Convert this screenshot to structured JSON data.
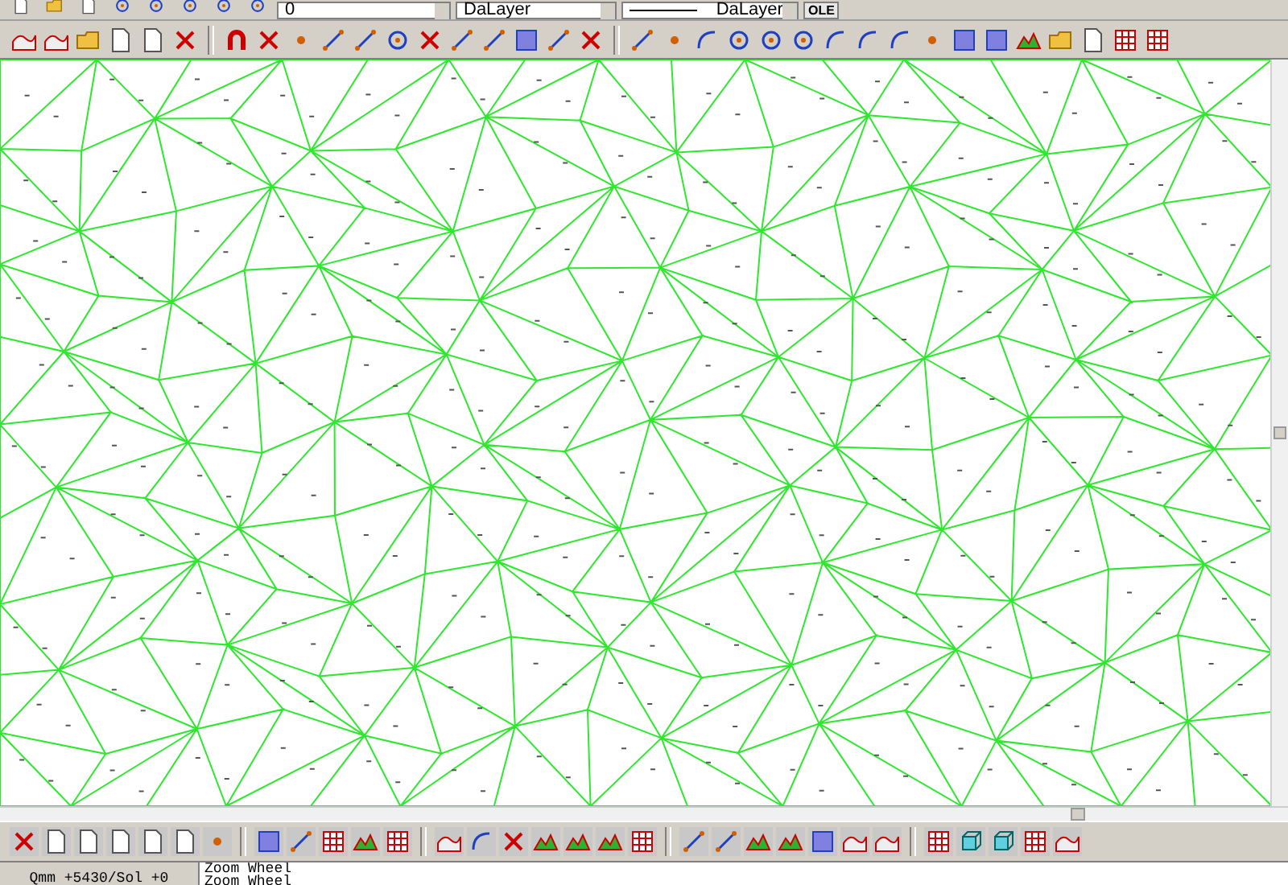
{
  "toolbar_top": {
    "layer_dropdown": {
      "value": "0"
    },
    "color_dropdown": {
      "value": "DaLayer"
    },
    "linetype_dropdown": {
      "value": "DaLayer"
    },
    "ole_button": {
      "label": "OLE"
    }
  },
  "status_bar": {
    "coordinates": "Qmm +5430/Sol +0"
  },
  "command_history": [
    {
      "text": "Zoom Wheel"
    },
    {
      "text": "Zoom Wheel"
    }
  ]
}
